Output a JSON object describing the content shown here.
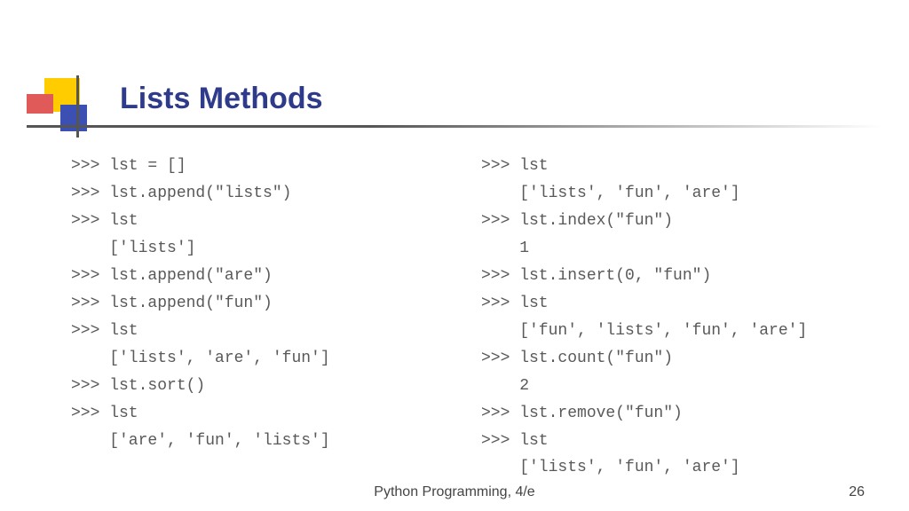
{
  "slide": {
    "title": "Lists Methods",
    "code_left": ">>> lst = []\n>>> lst.append(\"lists\")\n>>> lst\n    ['lists']\n>>> lst.append(\"are\")\n>>> lst.append(\"fun\")\n>>> lst\n    ['lists', 'are', 'fun']\n>>> lst.sort()\n>>> lst\n    ['are', 'fun', 'lists']",
    "code_right": ">>> lst\n    ['lists', 'fun', 'are']\n>>> lst.index(\"fun\")\n    1\n>>> lst.insert(0, \"fun\")\n>>> lst\n    ['fun', 'lists', 'fun', 'are']\n>>> lst.count(\"fun\")\n    2\n>>> lst.remove(\"fun\")\n>>> lst\n    ['lists', 'fun', 'are']",
    "footer": "Python Programming, 4/e",
    "page_number": "26"
  }
}
